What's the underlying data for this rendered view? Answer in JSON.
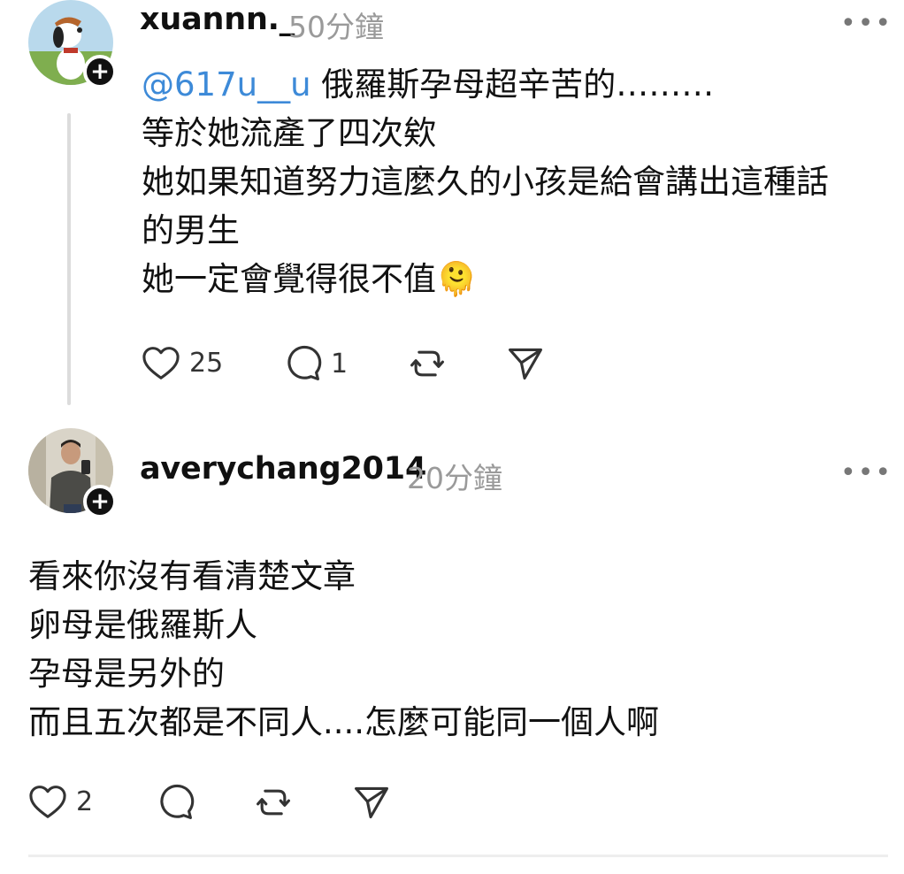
{
  "comments": [
    {
      "username": "xuannn._",
      "time": "50分鐘",
      "mention": "@617u__u",
      "lines": [
        " 俄羅斯孕母超辛苦的………",
        "等於她流產了四次欸",
        "她如果知道努力這麼久的小孩是給會講出這種話",
        "的男生",
        "她一定會覺得很不值"
      ],
      "emoji": "🫠",
      "likes": "25",
      "replies": "1"
    },
    {
      "username": "averychang2014",
      "time": "20分鐘",
      "lines": [
        "看來你沒有看清楚文章",
        "卵母是俄羅斯人",
        "孕母是另外的",
        "而且五次都是不同人....怎麼可能同一個人啊"
      ],
      "likes": "2"
    }
  ],
  "ui": {
    "more_glyph": "•••",
    "add_glyph": "+"
  },
  "colors": {
    "mention": "#3d8ad8",
    "timestamp": "#9a9a9a",
    "thread_line": "#dcdcdc"
  }
}
